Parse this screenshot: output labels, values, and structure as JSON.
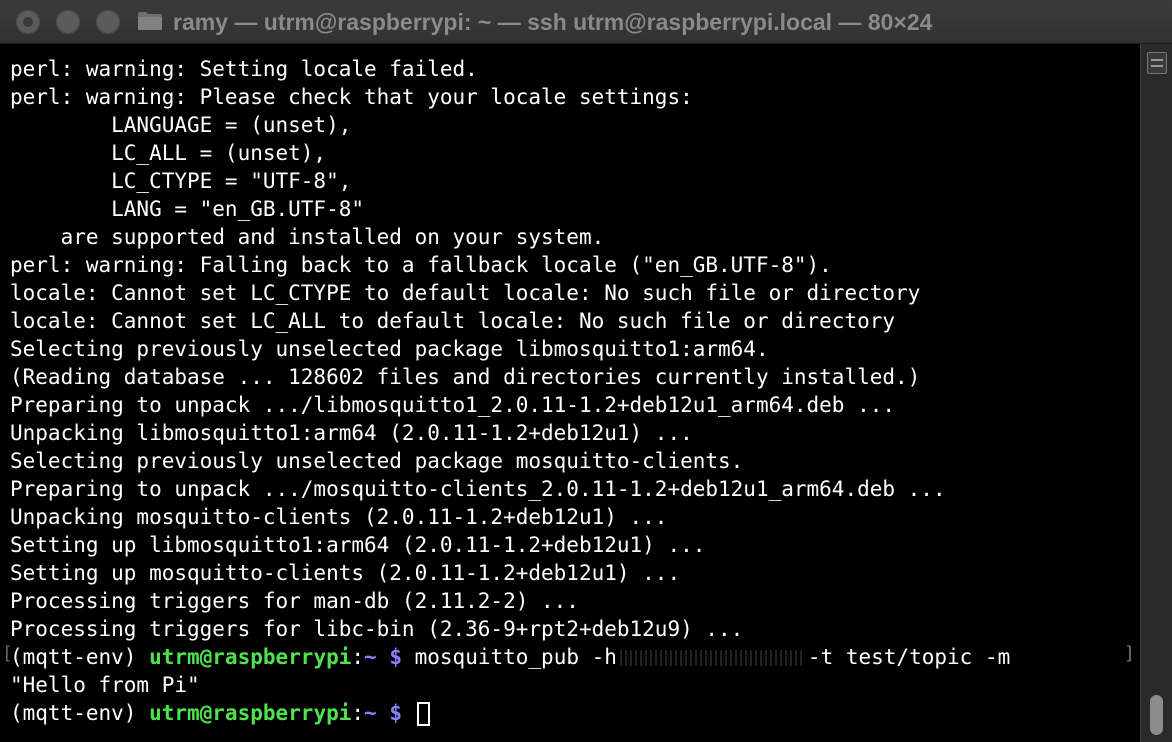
{
  "window": {
    "title": "ramy — utrm@raspberrypi: ~ — ssh utrm@raspberrypi.local — 80×24"
  },
  "icons": {
    "close": "close-icon",
    "minimize": "minimize-icon",
    "zoom": "zoom-icon",
    "folder": "folder-icon"
  },
  "colors": {
    "prompt_user": "#4fe24f",
    "prompt_path": "#8b82ff",
    "text": "#ffffff",
    "background": "#000000"
  },
  "output_lines": [
    "perl: warning: Setting locale failed.",
    "perl: warning: Please check that your locale settings:",
    "        LANGUAGE = (unset),",
    "        LC_ALL = (unset),",
    "        LC_CTYPE = \"UTF-8\",",
    "        LANG = \"en_GB.UTF-8\"",
    "    are supported and installed on your system.",
    "perl: warning: Falling back to a fallback locale (\"en_GB.UTF-8\").",
    "locale: Cannot set LC_CTYPE to default locale: No such file or directory",
    "locale: Cannot set LC_ALL to default locale: No such file or directory",
    "Selecting previously unselected package libmosquitto1:arm64.",
    "(Reading database ... 128602 files and directories currently installed.)",
    "Preparing to unpack .../libmosquitto1_2.0.11-1.2+deb12u1_arm64.deb ...",
    "Unpacking libmosquitto1:arm64 (2.0.11-1.2+deb12u1) ...",
    "Selecting previously unselected package mosquitto-clients.",
    "Preparing to unpack .../mosquitto-clients_2.0.11-1.2+deb12u1_arm64.deb ...",
    "Unpacking mosquitto-clients (2.0.11-1.2+deb12u1) ...",
    "Setting up libmosquitto1:arm64 (2.0.11-1.2+deb12u1) ...",
    "Setting up mosquitto-clients (2.0.11-1.2+deb12u1) ...",
    "Processing triggers for man-db (2.11.2-2) ...",
    "Processing triggers for libc-bin (2.36-9+rpt2+deb12u9) ..."
  ],
  "prompt1": {
    "env": "(mqtt-env) ",
    "user_host": "utrm@raspberrypi",
    "sep": ":",
    "path": "~",
    "dollar": " $",
    "command_start": " mosquitto_pub -h",
    "command_end": "-t test/topic -m",
    "continuation": "\"Hello from Pi\""
  },
  "prompt2": {
    "env": "(mqtt-env) ",
    "user_host": "utrm@raspberrypi",
    "sep": ":",
    "path": "~",
    "dollar": " $"
  },
  "wrap_markers": {
    "left": "[",
    "right": "]"
  }
}
